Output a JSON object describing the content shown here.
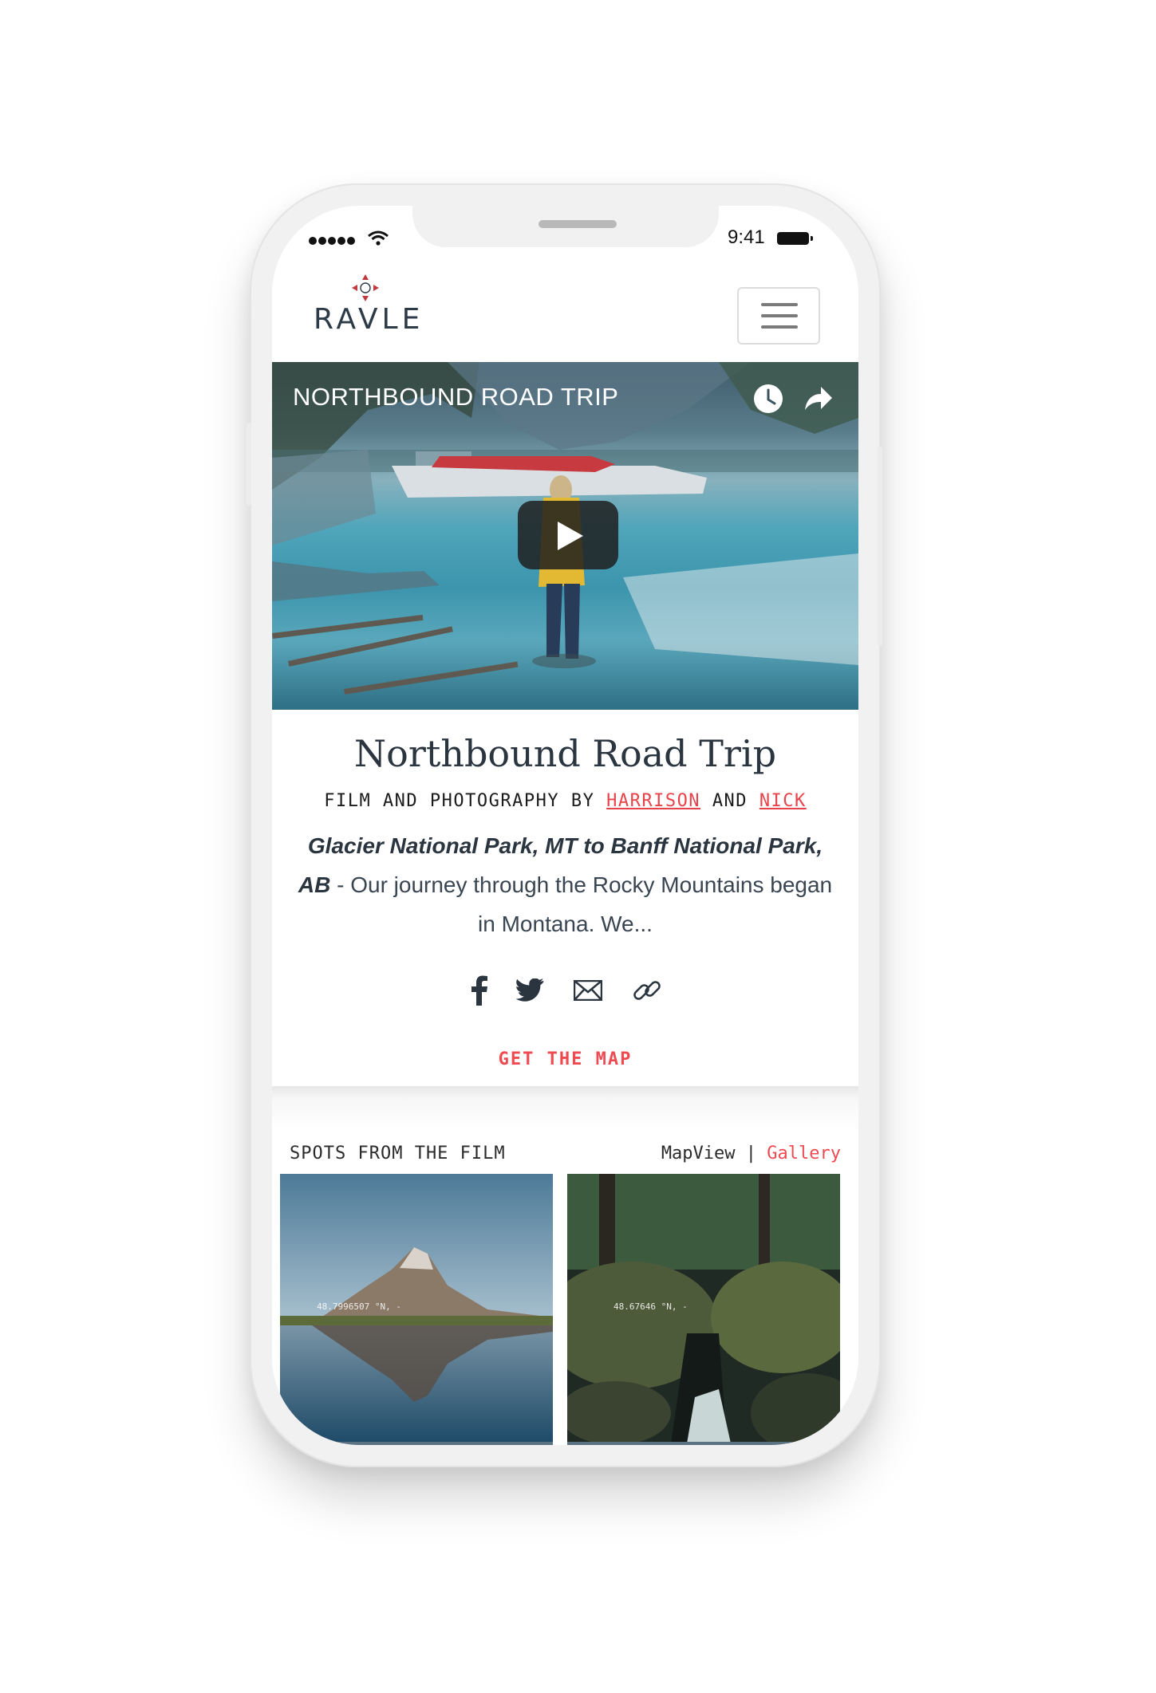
{
  "status_bar": {
    "time": "9:41"
  },
  "header": {
    "logo_text": "RAVLE"
  },
  "video": {
    "title": "NORTHBOUND ROAD TRIP"
  },
  "article": {
    "title": "Northbound Road Trip",
    "credit_prefix": "FILM AND PHOTOGRAPHY BY",
    "author_1": "HARRISON",
    "credit_and": "AND",
    "author_2": "NICK",
    "description_lead": "Glacier National Park, MT to Banff National Park, AB",
    "description_rest": " - Our journey through the Rocky Mountains began in Montana. We...",
    "cta": "GET THE MAP"
  },
  "spots": {
    "label": "SPOTS FROM THE FILM",
    "view_map": "MapView",
    "view_separator": "|",
    "view_gallery": "Gallery",
    "tiles": [
      {
        "coord": "48.7996507 °N, -"
      },
      {
        "coord": "48.67646 °N, -"
      }
    ]
  },
  "colors": {
    "accent": "#ef4a52",
    "text_dark": "#2b3540"
  },
  "icons": [
    "clock-icon",
    "share-arrow-icon",
    "play-icon",
    "facebook-icon",
    "twitter-icon",
    "email-icon",
    "link-icon"
  ]
}
